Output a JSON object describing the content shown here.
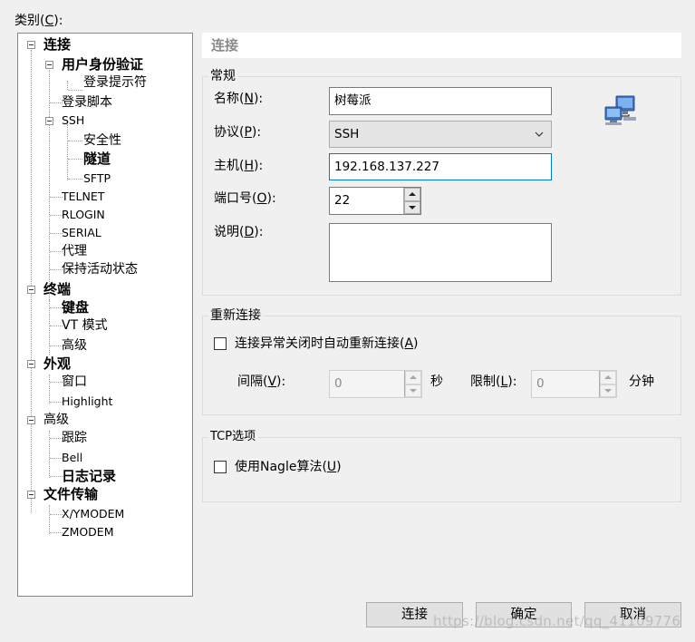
{
  "category": {
    "label": "类别(",
    "key": "C",
    "suffix": "):"
  },
  "tree": [
    {
      "label": "连接",
      "bold": true
    },
    {
      "label": "用户身份验证",
      "bold": true
    },
    {
      "label": "登录提示符"
    },
    {
      "label": "登录脚本"
    },
    {
      "label": "SSH"
    },
    {
      "label": "安全性"
    },
    {
      "label": "隧道",
      "bold": true
    },
    {
      "label": "SFTP"
    },
    {
      "label": "TELNET"
    },
    {
      "label": "RLOGIN"
    },
    {
      "label": "SERIAL"
    },
    {
      "label": "代理"
    },
    {
      "label": "保持活动状态"
    },
    {
      "label": "终端",
      "bold": true
    },
    {
      "label": "键盘",
      "bold": true
    },
    {
      "label": "VT 模式"
    },
    {
      "label": "高级"
    },
    {
      "label": "外观",
      "bold": true
    },
    {
      "label": "窗口"
    },
    {
      "label": "Highlight"
    },
    {
      "label": "高级"
    },
    {
      "label": "跟踪"
    },
    {
      "label": "Bell"
    },
    {
      "label": "日志记录",
      "bold": true
    },
    {
      "label": "文件传输",
      "bold": true
    },
    {
      "label": "X/YMODEM"
    },
    {
      "label": "ZMODEM"
    }
  ],
  "header": {
    "title": "连接"
  },
  "general": {
    "legend": "常规",
    "name": {
      "label": "名称(",
      "key": "N",
      "suffix": "):",
      "value": "树莓派"
    },
    "protocol": {
      "label": "协议(",
      "key": "P",
      "suffix": "):",
      "value": "SSH"
    },
    "host": {
      "label": "主机(",
      "key": "H",
      "suffix": "):",
      "value": "192.168.137.227"
    },
    "port": {
      "label": "端口号(",
      "key": "O",
      "suffix": "):",
      "value": "22"
    },
    "description": {
      "label": "说明(",
      "key": "D",
      "suffix": "):",
      "value": ""
    }
  },
  "reconnect": {
    "legend": "重新连接",
    "checkbox": {
      "label": "连接异常关闭时自动重新连接(",
      "key": "A",
      "suffix": ")",
      "checked": false
    },
    "interval": {
      "label": "间隔(",
      "key": "V",
      "suffix": "):",
      "value": "0",
      "unit": "秒"
    },
    "limit": {
      "label": "限制(",
      "key": "L",
      "suffix": "):",
      "value": "0",
      "unit": "分钟"
    }
  },
  "tcp": {
    "legend": "TCP选项",
    "checkbox": {
      "label": "使用Nagle算法(",
      "key": "U",
      "suffix": ")",
      "checked": false
    }
  },
  "buttons": {
    "connect": "连接",
    "ok": "确定",
    "cancel": "取消"
  },
  "watermark": "https://blog.csdn.net/qq_41109776",
  "colors": {
    "focus_border": "#0078d7",
    "header_text": "#8a8a8a"
  }
}
